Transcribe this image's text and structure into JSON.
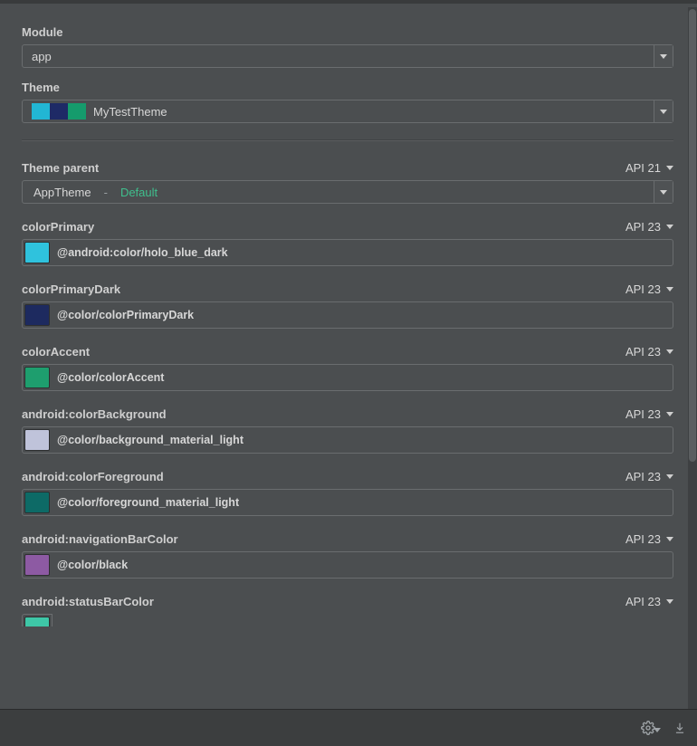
{
  "module": {
    "label": "Module",
    "value": "app"
  },
  "theme": {
    "label": "Theme",
    "value": "MyTestTheme",
    "swatches": [
      "#22b6d4",
      "#1e2a66",
      "#159b6c"
    ]
  },
  "themeParent": {
    "label": "Theme parent",
    "api": "API 21",
    "base": "AppTheme",
    "sep": "-",
    "variant": "Default"
  },
  "rows": [
    {
      "name": "colorPrimary",
      "api": "API 23",
      "swatch": "#2fc2dd",
      "value": "@android:color/holo_blue_dark"
    },
    {
      "name": "colorPrimaryDark",
      "api": "API 23",
      "swatch": "#1d2a5f",
      "value": "@color/colorPrimaryDark"
    },
    {
      "name": "colorAccent",
      "api": "API 23",
      "swatch": "#1e9e6e",
      "value": "@color/colorAccent"
    },
    {
      "name": "android:colorBackground",
      "api": "API 23",
      "swatch": "#bfc3da",
      "value": "@color/background_material_light"
    },
    {
      "name": "android:colorForeground",
      "api": "API 23",
      "swatch": "#0d6a66",
      "value": "@color/foreground_material_light"
    },
    {
      "name": "android:navigationBarColor",
      "api": "API 23",
      "swatch": "#8d5aa3",
      "value": "@color/black"
    }
  ],
  "lastRow": {
    "name": "android:statusBarColor",
    "api": "API 23",
    "swatch": "#3ec7a7"
  }
}
